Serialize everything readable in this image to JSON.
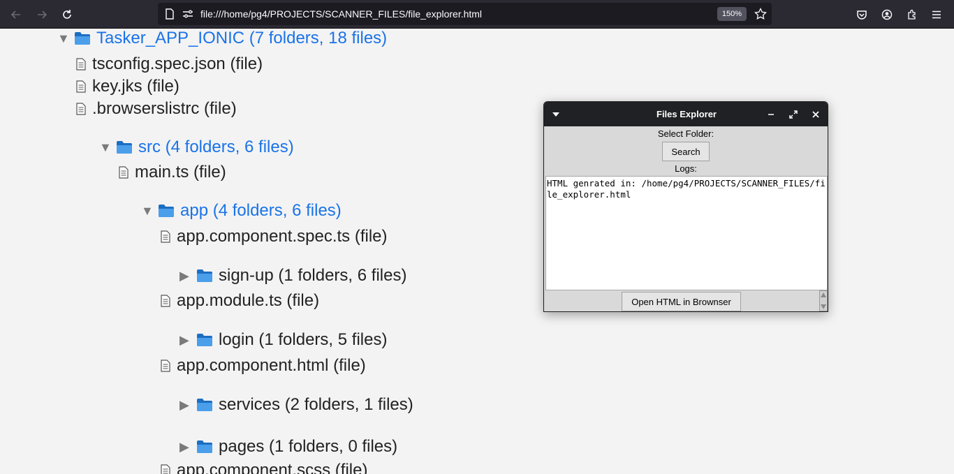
{
  "browser": {
    "url": "file:///home/pg4/PROJECTS/SCANNER_FILES/file_explorer.html",
    "zoom": "150%"
  },
  "tree": {
    "root": "Tasker_APP_IONIC (7 folders, 18 files)",
    "root_files": [
      "tsconfig.spec.json (file)",
      "key.jks (file)",
      ".browserslistrc (file)"
    ],
    "src": "src (4 folders, 6 files)",
    "src_files": [
      "main.ts (file)"
    ],
    "app": "app (4 folders, 6 files)",
    "app_items": [
      "app.component.spec.ts (file)",
      "sign-up (1 folders, 6 files)",
      "app.module.ts (file)",
      "login (1 folders, 5 files)",
      "app.component.html (file)",
      "services (2 folders, 1 files)",
      "pages (1 folders, 0 files)",
      "app.component.scss (file)"
    ]
  },
  "dialog": {
    "title": "Files Explorer",
    "select_label": "Select Folder:",
    "search_button": "Search",
    "logs_label": "Logs:",
    "logs_text": "HTML genrated in: /home/pg4/PROJECTS/SCANNER_FILES/file_explorer.html",
    "open_button": "Open HTML in Brownser"
  }
}
